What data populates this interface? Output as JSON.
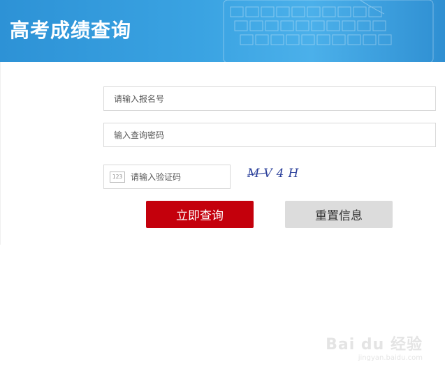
{
  "header": {
    "title": "高考成绩查询"
  },
  "form": {
    "registration_placeholder": "请输入报名号",
    "password_placeholder": "输入查询密码",
    "captcha_badge": "123",
    "captcha_placeholder": "请输入验证码",
    "captcha_text": "MV4H"
  },
  "buttons": {
    "submit_label": "立即查询",
    "reset_label": "重置信息"
  },
  "watermark": {
    "brand": "Bai du 经验",
    "url": "jingyan.baidu.com"
  },
  "colors": {
    "header_blue": "#3aa3e2",
    "primary_red": "#c4000c",
    "secondary_gray": "#dcdcdc",
    "captcha_ink": "#2a3f9a"
  }
}
